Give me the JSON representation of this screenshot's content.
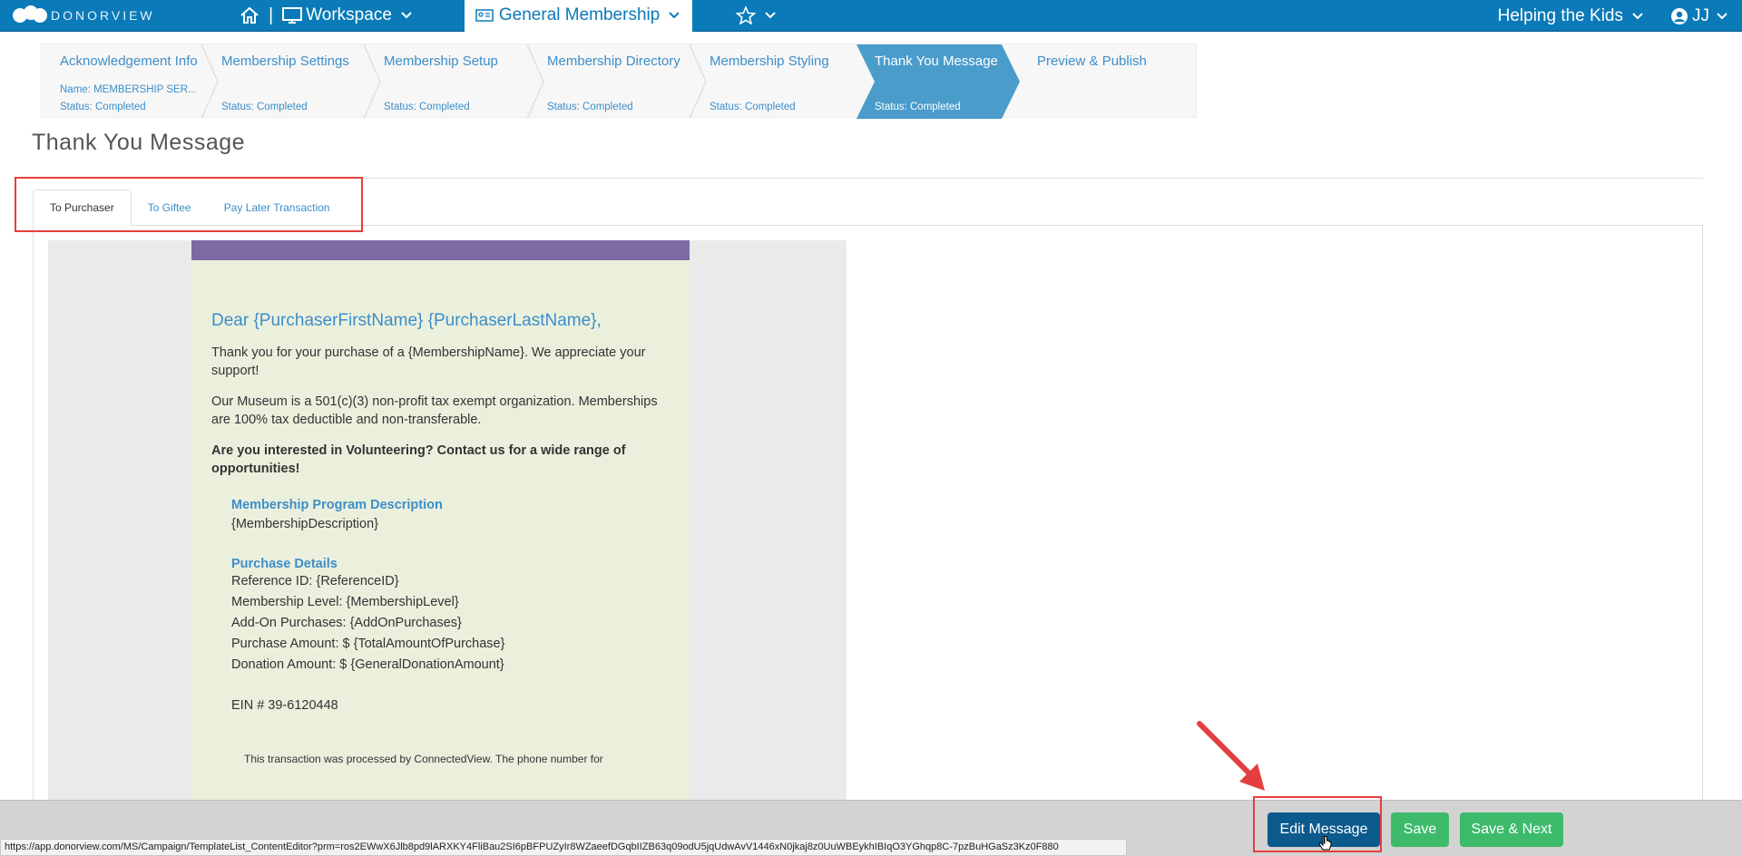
{
  "topbar": {
    "logo_text": "DONORVIEW",
    "separator": "|",
    "workspace_label": "Workspace",
    "campaign_label": "General Membership",
    "org_label": "Helping the Kids",
    "user_initials": "JJ",
    "icons": [
      "home-icon",
      "monitor-icon",
      "id-card-icon",
      "star-icon",
      "user-circle-icon",
      "chevron-down-icon"
    ]
  },
  "steps": [
    {
      "title": "Acknowledgement Info",
      "name": "Name: MEMBERSHIP SER...",
      "status": "Status: Completed"
    },
    {
      "title": "Membership Settings",
      "status": "Status: Completed"
    },
    {
      "title": "Membership Setup",
      "status": "Status: Completed"
    },
    {
      "title": "Membership Directory",
      "status": "Status: Completed"
    },
    {
      "title": "Membership Styling",
      "status": "Status: Completed"
    },
    {
      "title": "Thank You Message",
      "status": "Status: Completed",
      "active": true
    },
    {
      "title": "Preview & Publish"
    }
  ],
  "page_title": "Thank You Message",
  "tabs": [
    {
      "label": "To Purchaser",
      "active": true
    },
    {
      "label": "To Giftee"
    },
    {
      "label": "Pay Later Transaction"
    }
  ],
  "email": {
    "greeting": "Dear {PurchaserFirstName} {PurchaserLastName},",
    "para1": "Thank you for your purchase of a {MembershipName}. We appreciate your support!",
    "para2": "Our Museum is a 501(c)(3) non-profit tax exempt organization. Memberships are 100% tax deductible and non-transferable.",
    "para3": "Are you interested in Volunteering? Contact us for a wide range of opportunities!",
    "section1_heading": "Membership Program Description",
    "section1_text": "{MembershipDescription}",
    "section2_heading": "Purchase Details",
    "details": [
      "Reference ID: {ReferenceID}",
      "Membership Level: {MembershipLevel}",
      "Add-On Purchases: {AddOnPurchases}",
      "Purchase Amount: $ {TotalAmountOfPurchase}",
      "Donation Amount: $ {GeneralDonationAmount}"
    ],
    "ein": "EIN # 39-6120448",
    "footer": "This transaction was processed by ConnectedView. The phone number for"
  },
  "buttons": {
    "edit_message": "Edit Message",
    "save": "Save",
    "save_next": "Save & Next"
  },
  "status_url": "https://app.donorview.com/MS/Campaign/TemplateList_ContentEditor?prm=ros2EWwX6Jlb8pd9lARXKY4FliBau2SI6pBFPUZyIr8WZaeefDGqbIIZB63q09odU5jqUdwAvV1446xN0jkaj8z0UuWBEykhIBIqO3YGhqp8C-7pzBuHGaSz3Kz0F880",
  "colors": {
    "topbar": "#0a7ab8",
    "step_active": "#4a9ccb",
    "email_band": "#7d6aa4",
    "email_bg": "#ebf0dd",
    "button_primary": "#0d5a8d",
    "button_success": "#3dbb6b",
    "highlight": "#e53e3e"
  }
}
